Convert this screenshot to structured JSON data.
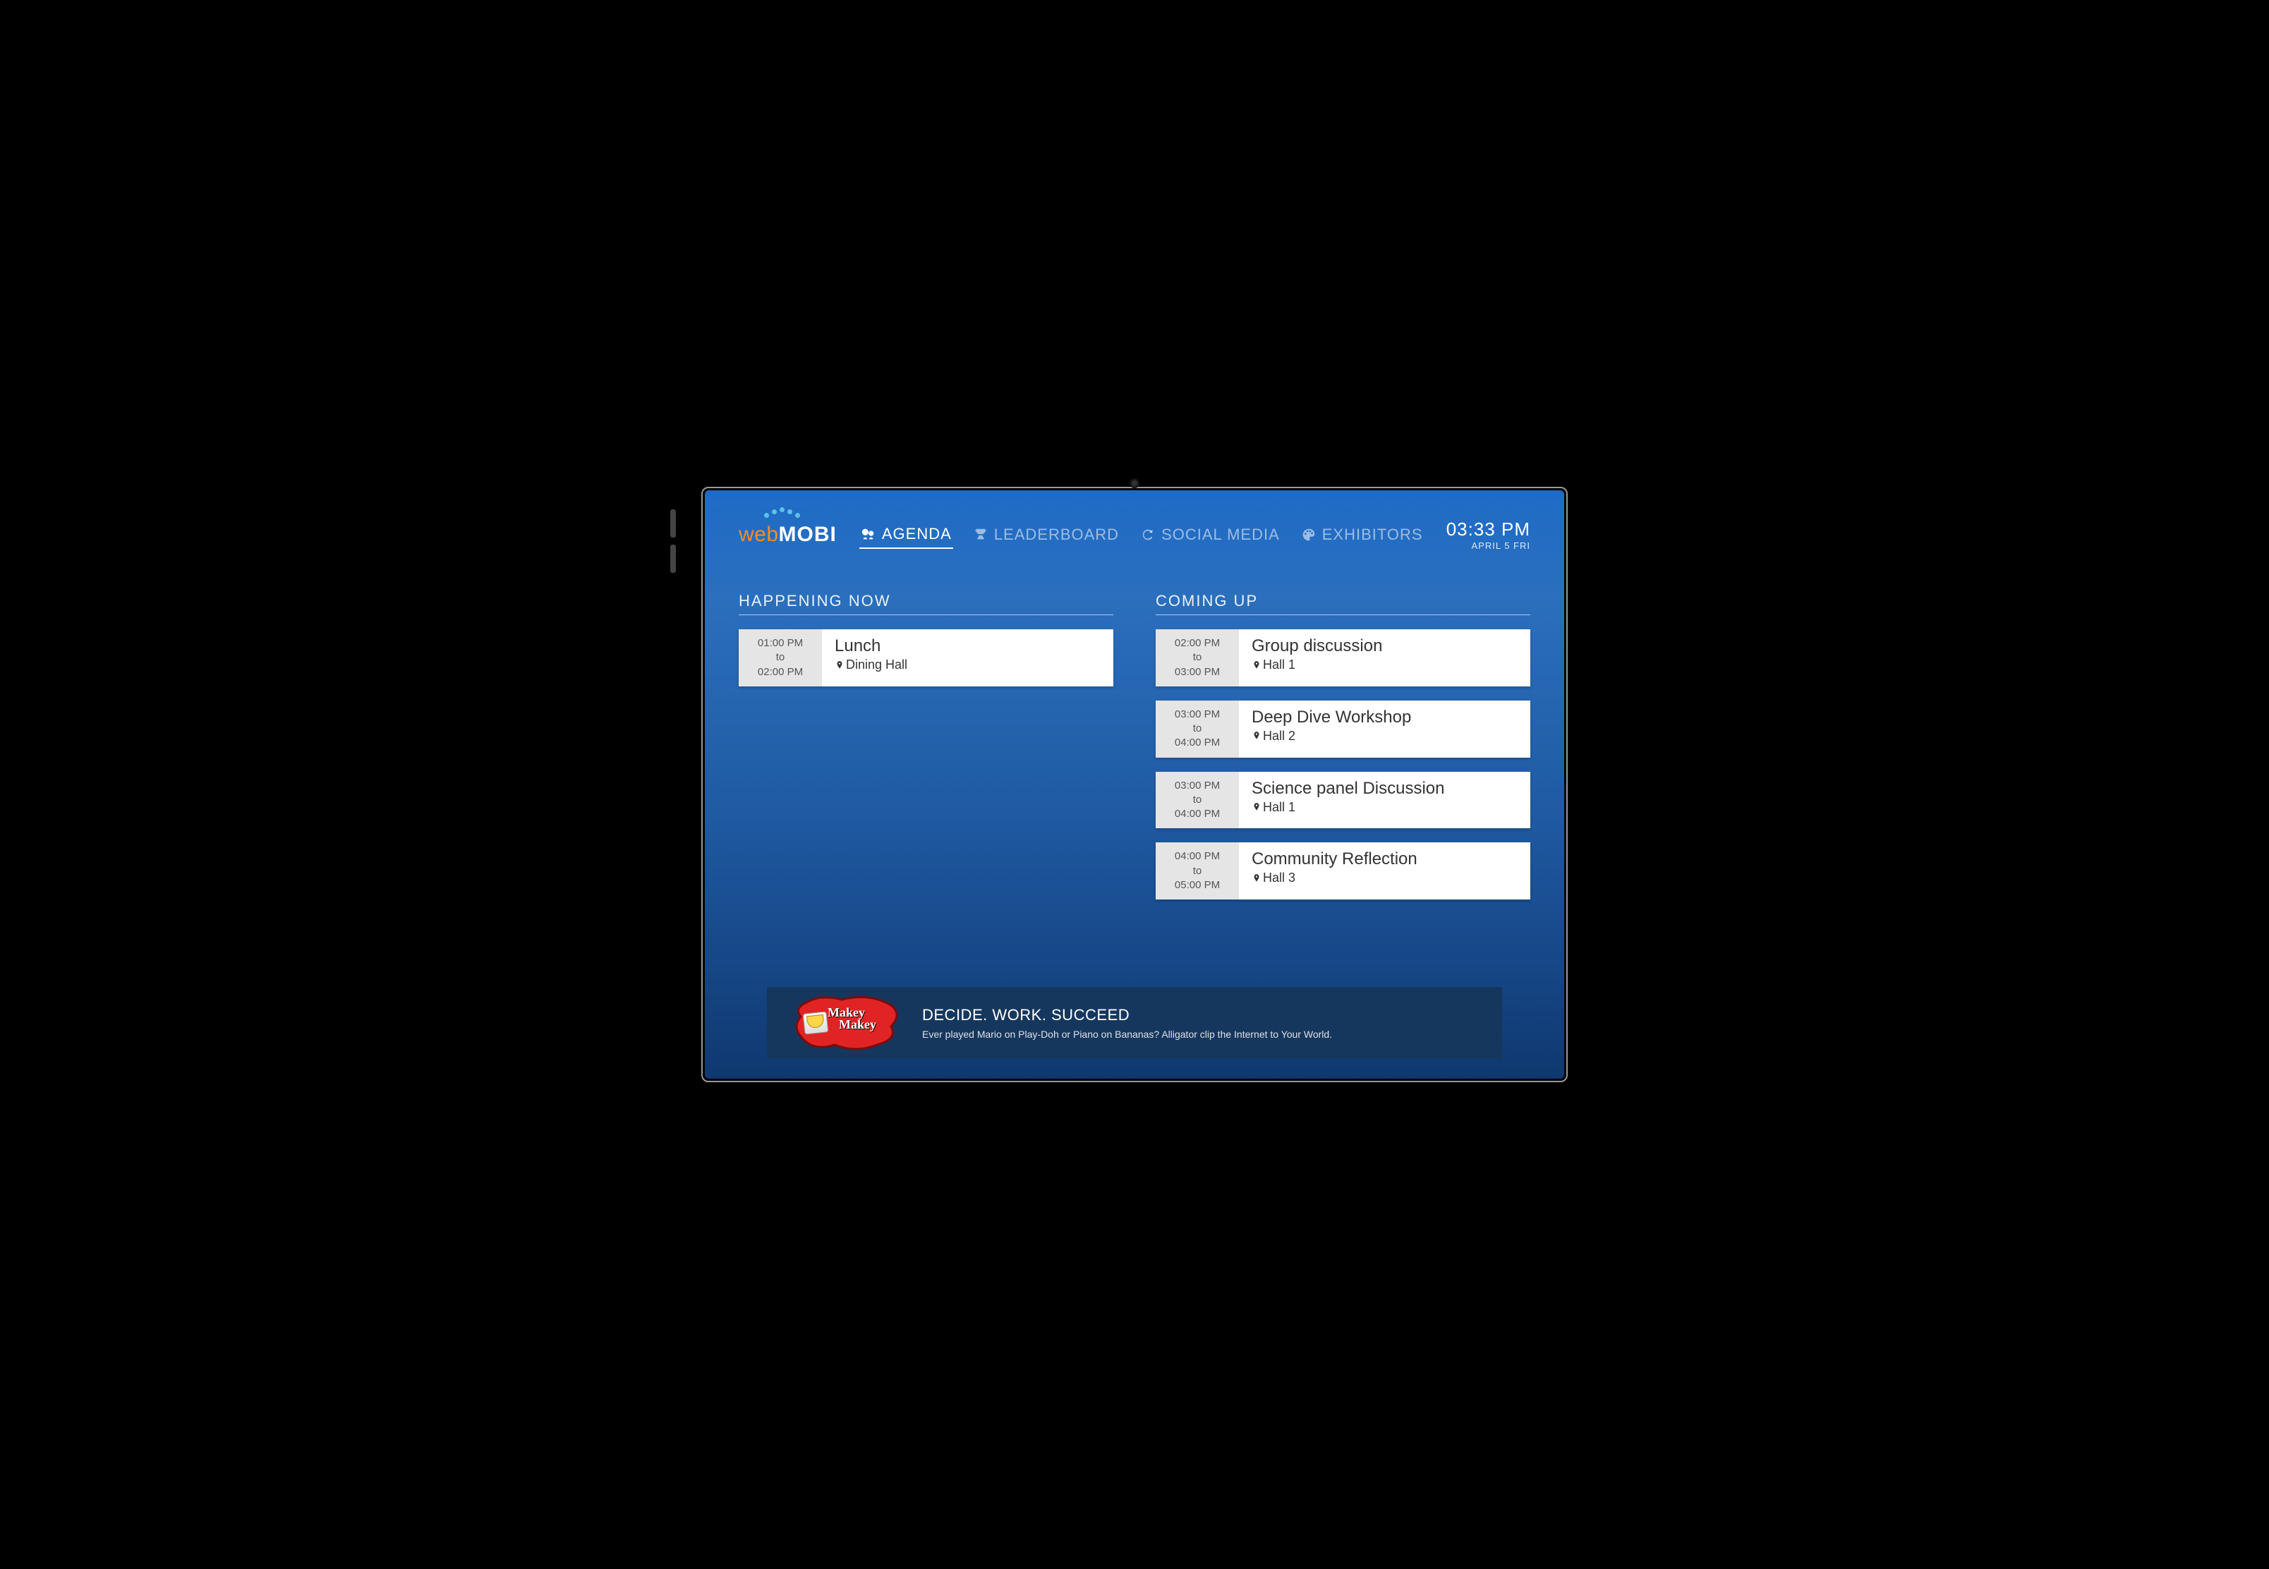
{
  "logo": {
    "part1": "web",
    "part2": "MOBI"
  },
  "tabs": {
    "agenda": "AGENDA",
    "leaderboard": "LEADERBOARD",
    "social": "SOCIAL MEDIA",
    "exhibitors": "EXHIBITORS"
  },
  "clock": {
    "time": "03:33 PM",
    "date": "APRIL 5 FRI"
  },
  "sections": {
    "now": "HAPPENING NOW",
    "up": "COMING UP"
  },
  "to_label": "to",
  "now_events": [
    {
      "start": "01:00 PM",
      "end": "02:00 PM",
      "title": "Lunch",
      "location": "Dining Hall"
    }
  ],
  "up_events": [
    {
      "start": "02:00 PM",
      "end": "03:00 PM",
      "title": "Group discussion",
      "location": "Hall 1"
    },
    {
      "start": "03:00 PM",
      "end": "04:00 PM",
      "title": "Deep Dive Workshop",
      "location": "Hall 2"
    },
    {
      "start": "03:00 PM",
      "end": "04:00 PM",
      "title": "Science panel Discussion",
      "location": "Hall 1"
    },
    {
      "start": "04:00 PM",
      "end": "05:00 PM",
      "title": "Community Reflection",
      "location": "Hall 3"
    }
  ],
  "sponsor": {
    "logo_text1": "Makey",
    "logo_text2": "Makey",
    "headline": "DECIDE. WORK. SUCCEED",
    "sub": "Ever played Mario on Play-Doh or Piano on Bananas? Alligator clip the Internet to Your World."
  }
}
